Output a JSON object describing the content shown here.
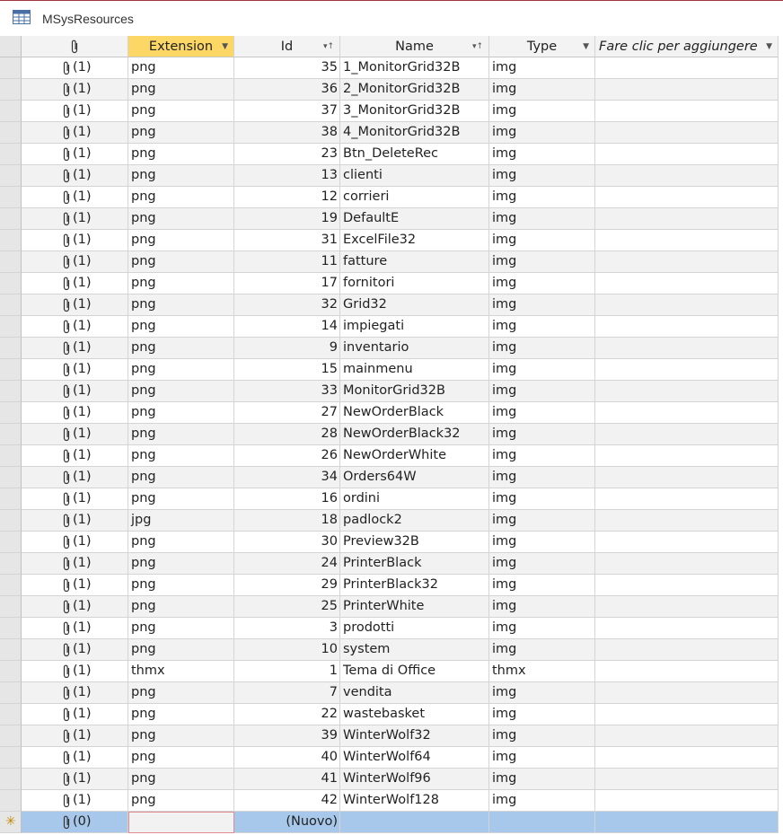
{
  "tab": {
    "title": "MSysResources",
    "icon": "table-icon"
  },
  "columns": {
    "attachment": "paperclip-icon",
    "extension": "Extension",
    "id": "Id",
    "name": "Name",
    "type": "Type",
    "add": "Fare clic per aggiungere"
  },
  "rows": [
    {
      "att": "(1)",
      "ext": "png",
      "id": "35",
      "name": "1_MonitorGrid32B",
      "type": "img"
    },
    {
      "att": "(1)",
      "ext": "png",
      "id": "36",
      "name": "2_MonitorGrid32B",
      "type": "img"
    },
    {
      "att": "(1)",
      "ext": "png",
      "id": "37",
      "name": "3_MonitorGrid32B",
      "type": "img"
    },
    {
      "att": "(1)",
      "ext": "png",
      "id": "38",
      "name": "4_MonitorGrid32B",
      "type": "img"
    },
    {
      "att": "(1)",
      "ext": "png",
      "id": "23",
      "name": "Btn_DeleteRec",
      "type": "img"
    },
    {
      "att": "(1)",
      "ext": "png",
      "id": "13",
      "name": "clienti",
      "type": "img"
    },
    {
      "att": "(1)",
      "ext": "png",
      "id": "12",
      "name": "corrieri",
      "type": "img"
    },
    {
      "att": "(1)",
      "ext": "png",
      "id": "19",
      "name": "DefaultE",
      "type": "img"
    },
    {
      "att": "(1)",
      "ext": "png",
      "id": "31",
      "name": "ExcelFile32",
      "type": "img"
    },
    {
      "att": "(1)",
      "ext": "png",
      "id": "11",
      "name": "fatture",
      "type": "img"
    },
    {
      "att": "(1)",
      "ext": "png",
      "id": "17",
      "name": "fornitori",
      "type": "img"
    },
    {
      "att": "(1)",
      "ext": "png",
      "id": "32",
      "name": "Grid32",
      "type": "img"
    },
    {
      "att": "(1)",
      "ext": "png",
      "id": "14",
      "name": "impiegati",
      "type": "img"
    },
    {
      "att": "(1)",
      "ext": "png",
      "id": "9",
      "name": "inventario",
      "type": "img"
    },
    {
      "att": "(1)",
      "ext": "png",
      "id": "15",
      "name": "mainmenu",
      "type": "img"
    },
    {
      "att": "(1)",
      "ext": "png",
      "id": "33",
      "name": "MonitorGrid32B",
      "type": "img"
    },
    {
      "att": "(1)",
      "ext": "png",
      "id": "27",
      "name": "NewOrderBlack",
      "type": "img"
    },
    {
      "att": "(1)",
      "ext": "png",
      "id": "28",
      "name": "NewOrderBlack32",
      "type": "img"
    },
    {
      "att": "(1)",
      "ext": "png",
      "id": "26",
      "name": "NewOrderWhite",
      "type": "img"
    },
    {
      "att": "(1)",
      "ext": "png",
      "id": "34",
      "name": "Orders64W",
      "type": "img"
    },
    {
      "att": "(1)",
      "ext": "png",
      "id": "16",
      "name": "ordini",
      "type": "img"
    },
    {
      "att": "(1)",
      "ext": "jpg",
      "id": "18",
      "name": "padlock2",
      "type": "img"
    },
    {
      "att": "(1)",
      "ext": "png",
      "id": "30",
      "name": "Preview32B",
      "type": "img"
    },
    {
      "att": "(1)",
      "ext": "png",
      "id": "24",
      "name": "PrinterBlack",
      "type": "img"
    },
    {
      "att": "(1)",
      "ext": "png",
      "id": "29",
      "name": "PrinterBlack32",
      "type": "img"
    },
    {
      "att": "(1)",
      "ext": "png",
      "id": "25",
      "name": "PrinterWhite",
      "type": "img"
    },
    {
      "att": "(1)",
      "ext": "png",
      "id": "3",
      "name": "prodotti",
      "type": "img"
    },
    {
      "att": "(1)",
      "ext": "png",
      "id": "10",
      "name": "system",
      "type": "img"
    },
    {
      "att": "(1)",
      "ext": "thmx",
      "id": "1",
      "name": "Tema di Office",
      "type": "thmx"
    },
    {
      "att": "(1)",
      "ext": "png",
      "id": "7",
      "name": "vendita",
      "type": "img"
    },
    {
      "att": "(1)",
      "ext": "png",
      "id": "22",
      "name": "wastebasket",
      "type": "img"
    },
    {
      "att": "(1)",
      "ext": "png",
      "id": "39",
      "name": "WinterWolf32",
      "type": "img"
    },
    {
      "att": "(1)",
      "ext": "png",
      "id": "40",
      "name": "WinterWolf64",
      "type": "img"
    },
    {
      "att": "(1)",
      "ext": "png",
      "id": "41",
      "name": "WinterWolf96",
      "type": "img"
    },
    {
      "att": "(1)",
      "ext": "png",
      "id": "42",
      "name": "WinterWolf128",
      "type": "img"
    }
  ],
  "new_row": {
    "marker": "✳",
    "att": "(0)",
    "ext": "",
    "id": "(Nuovo)"
  },
  "colors": {
    "sorted_header": "#fcd766",
    "new_row": "#a7c8ea",
    "tab_border": "#a4373a"
  }
}
